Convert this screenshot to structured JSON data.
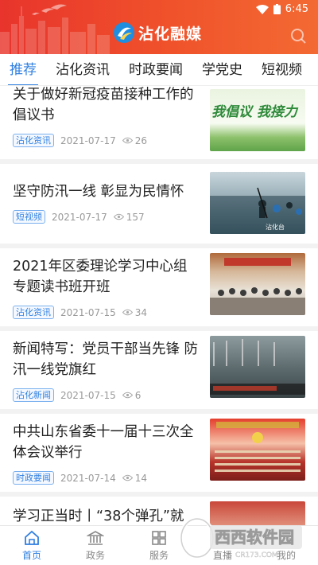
{
  "status_bar": {
    "time": "6:45"
  },
  "header": {
    "logo_text": "沾化融媒"
  },
  "tabs": [
    {
      "label": "推荐",
      "active": true
    },
    {
      "label": "沾化资讯",
      "active": false
    },
    {
      "label": "时政要闻",
      "active": false
    },
    {
      "label": "学党史",
      "active": false
    },
    {
      "label": "短视频",
      "active": false
    }
  ],
  "news": [
    {
      "title": "关于做好新冠疫苗接种工作的倡议书",
      "tag": "沾化资讯",
      "date": "2021-07-17",
      "views": "26",
      "thumb_text": "我倡议  我接力"
    },
    {
      "title": "坚守防汛一线 彰显为民情怀",
      "tag": "短视频",
      "date": "2021-07-17",
      "views": "157",
      "thumb_text": "沾化台"
    },
    {
      "title": "2021年区委理论学习中心组专题读书班开班",
      "tag": "沾化资讯",
      "date": "2021-07-15",
      "views": "34",
      "thumb_text": ""
    },
    {
      "title": "新闻特写：党员干部当先锋 防汛一线党旗红",
      "tag": "沾化新闻",
      "date": "2021-07-15",
      "views": "6",
      "thumb_text": ""
    },
    {
      "title": "中共山东省委十一届十三次全体会议举行",
      "tag": "时政要闻",
      "date": "2021-07-14",
      "views": "14",
      "thumb_text": ""
    },
    {
      "title": "学习正当时丨“38个弹孔”就",
      "tag": "",
      "date": "",
      "views": "",
      "thumb_text": ""
    }
  ],
  "bottom_nav": [
    {
      "label": "首页",
      "active": true
    },
    {
      "label": "政务",
      "active": false
    },
    {
      "label": "服务",
      "active": false
    },
    {
      "label": "直播",
      "active": false
    },
    {
      "label": "我的",
      "active": false
    }
  ],
  "watermark": {
    "brand": "西西软件园",
    "domain": "CR173.COM"
  },
  "colors": {
    "accent": "#2f7fe0",
    "header_red": "#e8342c"
  }
}
